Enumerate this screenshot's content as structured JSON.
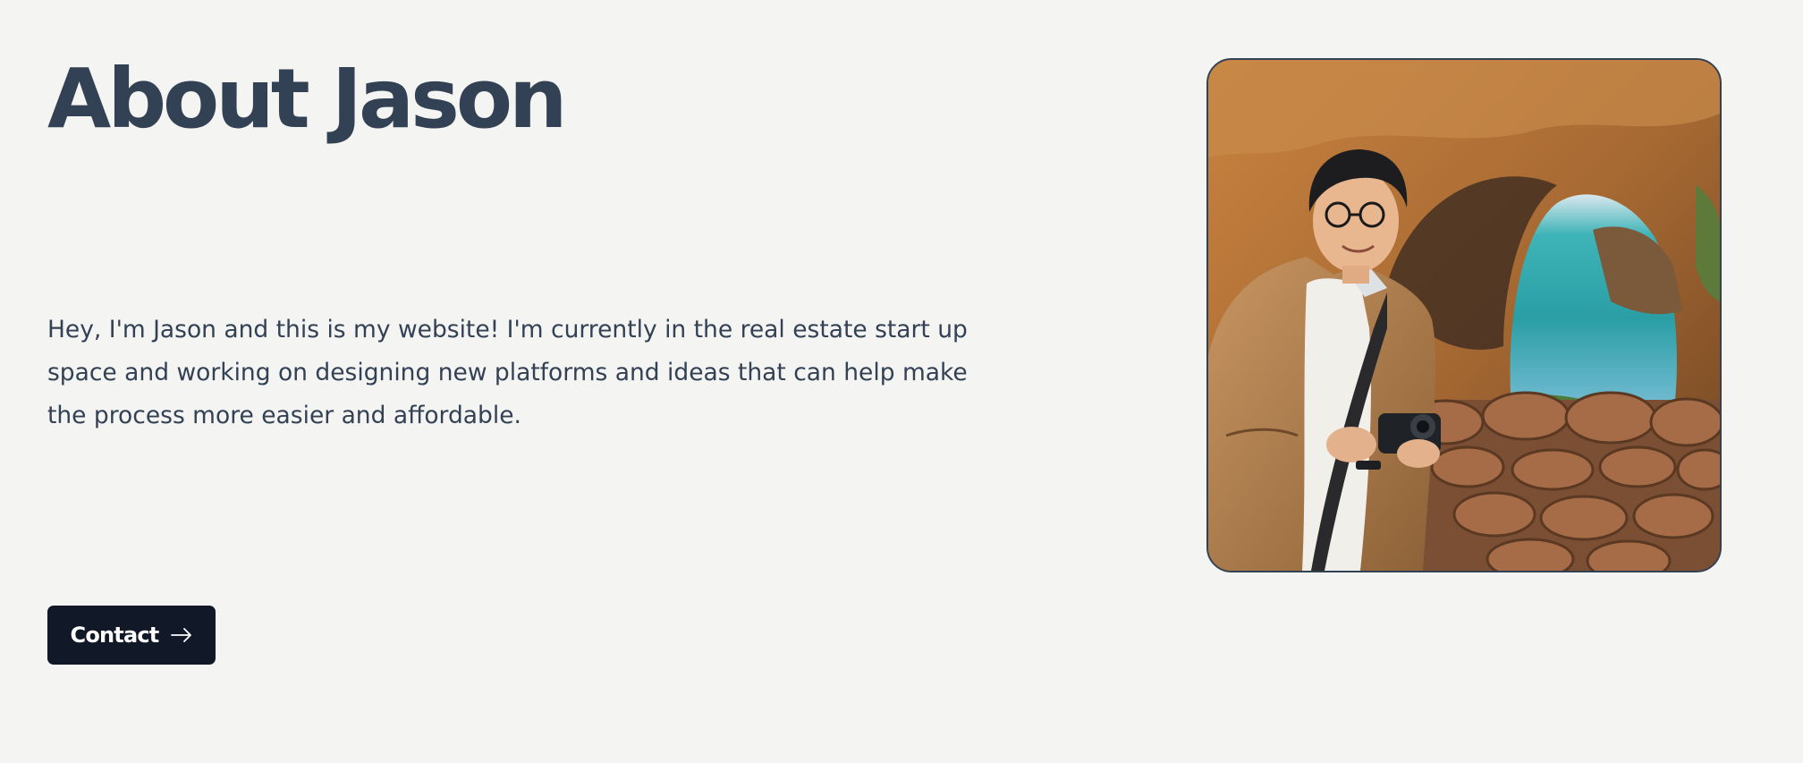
{
  "about": {
    "title": "About Jason",
    "bio": "Hey, I'm Jason and this is my website! I'm currently in the real estate start up space and working on designing new platforms and ideas that can help make the process more easier and affordable.",
    "contact_label": "Contact",
    "contact_icon": "arrow-right-icon",
    "photo_icon": "profile-photo"
  },
  "colors": {
    "background": "#f4f4f2",
    "text": "#334155",
    "button": "#111827",
    "button_text": "#ffffff"
  }
}
